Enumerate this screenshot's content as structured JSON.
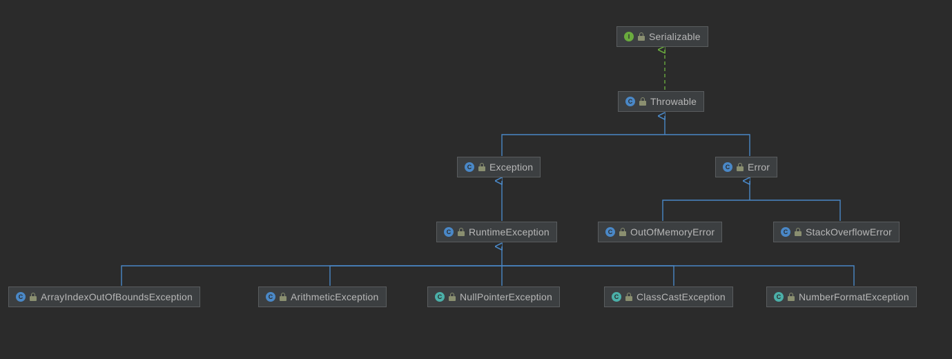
{
  "nodes": {
    "serializable": {
      "label": "Serializable",
      "kind": "interface"
    },
    "throwable": {
      "label": "Throwable",
      "kind": "class_blue"
    },
    "exception": {
      "label": "Exception",
      "kind": "class_blue"
    },
    "error": {
      "label": "Error",
      "kind": "class_blue"
    },
    "runtimeexception": {
      "label": "RuntimeException",
      "kind": "class_blue"
    },
    "outofmemoryerror": {
      "label": "OutOfMemoryError",
      "kind": "class_blue"
    },
    "stackoverflowerror": {
      "label": "StackOverflowError",
      "kind": "class_blue"
    },
    "arrayindex": {
      "label": "ArrayIndexOutOfBoundsException",
      "kind": "class_blue"
    },
    "arithmetic": {
      "label": "ArithmeticException",
      "kind": "class_blue"
    },
    "nullpointer": {
      "label": "NullPointerException",
      "kind": "class_teal"
    },
    "classcast": {
      "label": "ClassCastException",
      "kind": "class_teal"
    },
    "numberformat": {
      "label": "NumberFormatException",
      "kind": "class_teal"
    }
  },
  "edges": [
    {
      "from": "throwable",
      "to": "serializable",
      "style": "implements"
    },
    {
      "from": "exception",
      "to": "throwable",
      "style": "extends"
    },
    {
      "from": "error",
      "to": "throwable",
      "style": "extends"
    },
    {
      "from": "runtimeexception",
      "to": "exception",
      "style": "extends"
    },
    {
      "from": "outofmemoryerror",
      "to": "error",
      "style": "extends"
    },
    {
      "from": "stackoverflowerror",
      "to": "error",
      "style": "extends"
    },
    {
      "from": "arrayindex",
      "to": "runtimeexception",
      "style": "extends"
    },
    {
      "from": "arithmetic",
      "to": "runtimeexception",
      "style": "extends"
    },
    {
      "from": "nullpointer",
      "to": "runtimeexception",
      "style": "extends"
    },
    {
      "from": "classcast",
      "to": "runtimeexception",
      "style": "extends"
    },
    {
      "from": "numberformat",
      "to": "runtimeexception",
      "style": "extends"
    }
  ],
  "colors": {
    "extends": "#4a88c7",
    "implements": "#6aab3e"
  }
}
